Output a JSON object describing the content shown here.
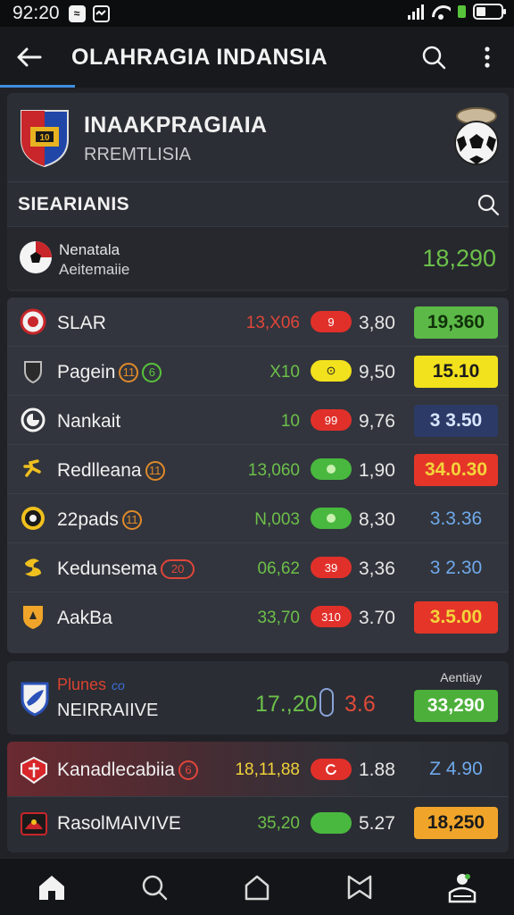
{
  "status_bar": {
    "time": "92:20",
    "app_icon_label": "≈"
  },
  "app_bar": {
    "title": "OLAHRAGIA INDANSIA"
  },
  "league": {
    "name": "INAAKPRAGIAIA",
    "country": "RREMTLISIA"
  },
  "standings": {
    "label": "SIEARIANIS"
  },
  "featured": {
    "line1": "Nenatala",
    "line2": "Aeitemaiie",
    "value": "18,290"
  },
  "matches": [
    {
      "team": "SLAR",
      "badge": "",
      "odds": "13,X06",
      "pill": "9",
      "mid": "3,80",
      "value": "19,360"
    },
    {
      "team": "Pagein",
      "badge": "11",
      "badge2": "6",
      "odds": "X10",
      "pill": "⊙",
      "mid": "9,50",
      "value": "15.10"
    },
    {
      "team": "Nankait",
      "badge": "",
      "odds": "10",
      "pill": "99",
      "mid": "9,76",
      "value": "3 3.50"
    },
    {
      "team": "Redlleana",
      "badge": "11",
      "odds": "13,060",
      "pill": "",
      "mid": "1,90",
      "value": "34.0.30"
    },
    {
      "team": "22pads",
      "badge": "11",
      "odds": "N,003",
      "pill": "",
      "mid": "8,30",
      "value": "3.3.36"
    },
    {
      "team": "Kedunsema",
      "badge": "20",
      "odds": "06,62",
      "pill": "39",
      "mid": "3,36",
      "value": "3 2.30"
    },
    {
      "team": "AakBa",
      "badge": "",
      "odds": "33,70",
      "pill": "310",
      "mid": "3.70",
      "value": "3.5.00"
    }
  ],
  "special": {
    "line1": "Plunes",
    "line1_tag": "co",
    "line2": "NEIRRAIIVE",
    "odds": "17.,20",
    "mid": "3.6",
    "label": "Aentiay",
    "value": "33,290"
  },
  "bottom": [
    {
      "team": "Kanadlecabiia",
      "badge": "6",
      "odds": "18,11,88",
      "pill": "",
      "mid": "1.88",
      "value": "Z 4.90"
    },
    {
      "team": "RasolMAIVIVE",
      "badge": "",
      "odds": "35,20",
      "pill": "",
      "mid": "5.27",
      "value": "18,250"
    }
  ],
  "colors": {
    "green_box": "#5cb947",
    "yellow_box": "#f2e11d",
    "navy_box": "#2b3a66",
    "red_box": "#e53529",
    "orange_box": "#f0a52a",
    "pill_red": "#e1302a",
    "pill_yellow": "#f2e11d",
    "pill_green": "#49b83f",
    "odds_red": "#e0463a",
    "odds_green": "#6cc04a",
    "odds_yellow": "#f0d23a",
    "blue_text": "#6fa8ea"
  },
  "icons": {
    "nav": [
      "home-icon",
      "search-icon",
      "house-outline-icon",
      "bookmark-icon",
      "profile-icon"
    ]
  }
}
